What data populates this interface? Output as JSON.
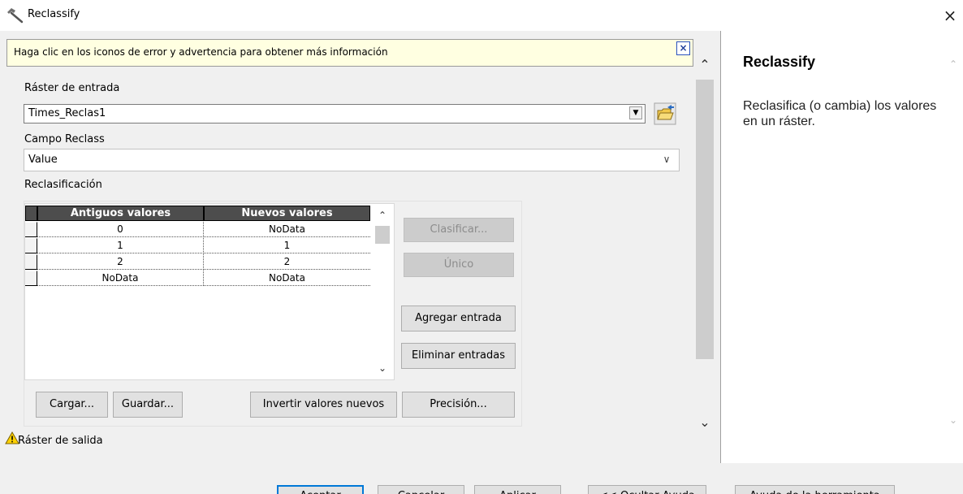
{
  "window": {
    "title": "Reclassify",
    "close_glyph": "×"
  },
  "info_bar": {
    "text": "Haga clic en los iconos de error y advertencia para obtener más información",
    "close_glyph": "×"
  },
  "form": {
    "raster_label": "Ráster de entrada",
    "raster_value": "Times_Reclas1",
    "campo_label": "Campo Reclass",
    "campo_value": "Value",
    "reclas_label": "Reclasificación",
    "table": {
      "headers": [
        "Antiguos valores",
        "Nuevos valores"
      ],
      "rows": [
        [
          "0",
          "NoData"
        ],
        [
          "1",
          "1"
        ],
        [
          "2",
          "2"
        ],
        [
          "NoData",
          "NoData"
        ]
      ]
    },
    "buttons": {
      "clasificar": "Clasificar...",
      "unico": "Único",
      "agregar": "Agregar entrada",
      "eliminar": "Eliminar entradas",
      "cargar": "Cargar...",
      "guardar": "Guardar...",
      "invertir": "Invertir valores nuevos",
      "precision": "Precisión..."
    },
    "salida_label": "Ráster de salida"
  },
  "help": {
    "title": "Reclassify",
    "description": "Reclasifica (o cambia) los valores en un ráster."
  },
  "footer": {
    "aceptar": "Aceptar",
    "cancelar": "Cancelar",
    "aplicar": "Aplicar",
    "ocultar": "<< Ocultar Ayuda",
    "ayuda": "Ayuda de la herramienta"
  },
  "icons": {
    "title": "hammer-icon",
    "folder": "open-folder-icon",
    "warning": "warning-icon"
  }
}
